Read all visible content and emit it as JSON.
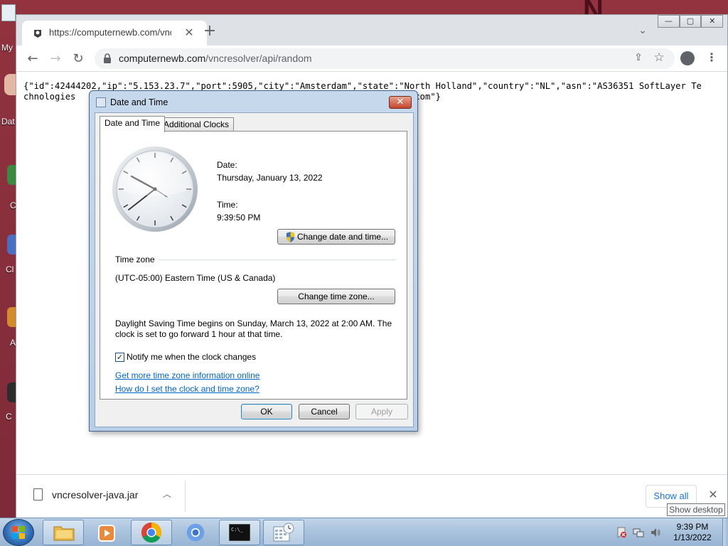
{
  "desktop": {
    "icon_labels": [
      "My",
      "Dat",
      "C",
      "Cl",
      "A",
      "C"
    ]
  },
  "browser": {
    "tab_title": "https://computernewb.com/vncr",
    "tab_close": "✕",
    "new_tab": "+",
    "url_host": "computernewb.com",
    "url_path": "/vncresolver/api/random",
    "window_buttons": [
      "—",
      "▢",
      "✕"
    ]
  },
  "page": {
    "json_text": "{\"id\":42444202,\"ip\":\"5.153.23.7\",\"port\":5905,\"city\":\"Amsterdam\",\"state\":\"North Holland\",\"country\":\"NL\",\"asn\":\"AS36351 SoftLayer Technologies                                         \":\"serveur83.heberjahiz.com\"}"
  },
  "downloads": {
    "file_name": "vncresolver-java.jar",
    "show_all": "Show all",
    "close": "✕"
  },
  "dialog": {
    "title": "Date and Time",
    "tabs": [
      "Date and Time",
      "Additional Clocks"
    ],
    "date_label": "Date:",
    "date_value": "Thursday, January 13, 2022",
    "time_label": "Time:",
    "time_value": "9:39:50 PM",
    "change_datetime_btn": "Change date and time...",
    "timezone_header": "Time zone",
    "timezone_value": "(UTC-05:00) Eastern Time (US & Canada)",
    "change_timezone_btn": "Change time zone...",
    "dst_line1": "Daylight Saving Time begins on Sunday, March 13, 2022 at 2:00 AM. The",
    "dst_line2": "clock is set to go forward 1 hour at that time.",
    "notify_label": "Notify me when the clock changes",
    "notify_checked": true,
    "link1": "Get more time zone information online",
    "link2": "How do I set the clock and time zone?",
    "ok": "OK",
    "cancel": "Cancel",
    "apply": "Apply"
  },
  "taskbar": {
    "clock_time": "9:39 PM",
    "clock_date": "1/13/2022",
    "tooltip": "Show desktop"
  },
  "colors": {
    "accent": "#1a73e8",
    "link": "#0066cc",
    "desktop": "#8b3040"
  }
}
